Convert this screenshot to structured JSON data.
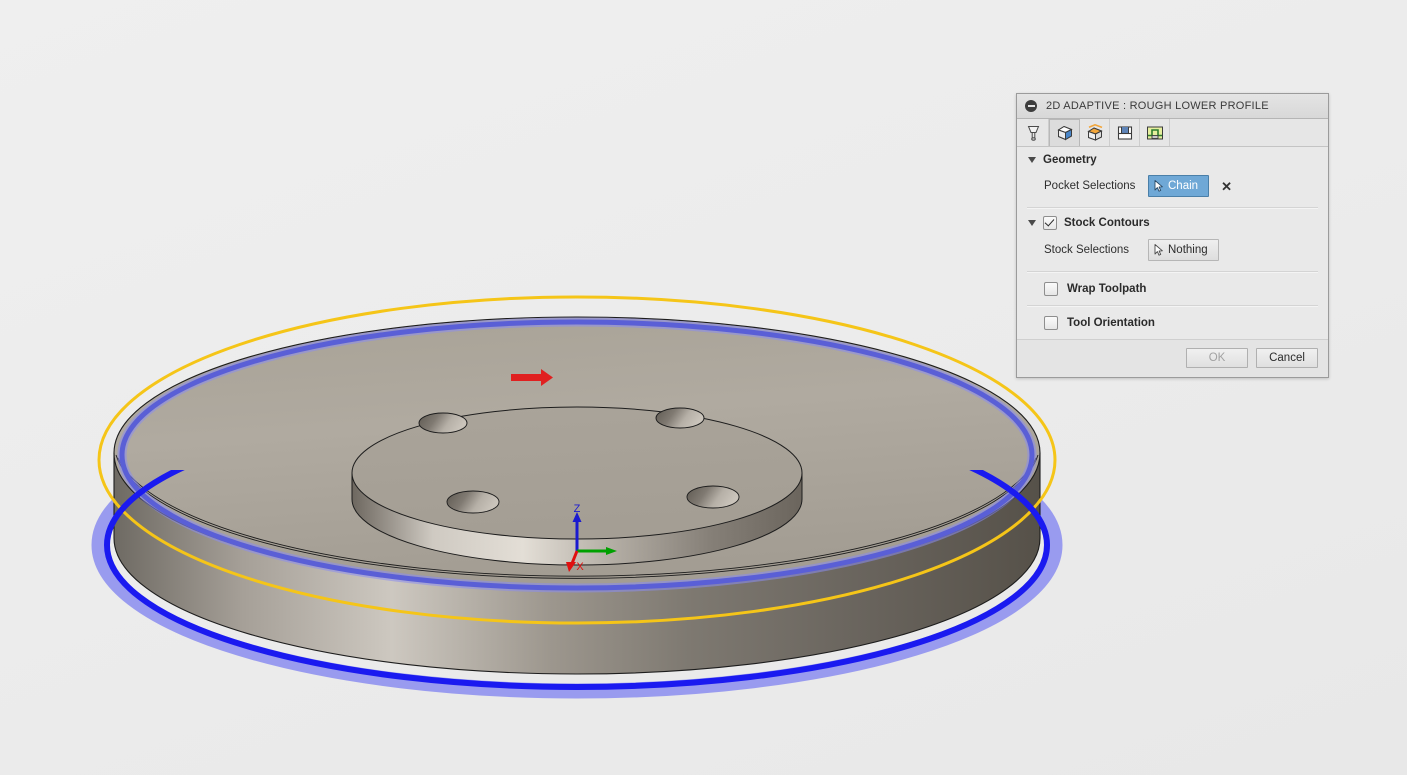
{
  "viewport": {
    "name": "cam-3d-viewport",
    "background_color": "#ececec",
    "model": {
      "description": "Cylindrical disc part with recessed circular pocket and four bolt holes",
      "body_color": "#a9a49a",
      "edge_color": "#1a1a1a"
    },
    "overlays": {
      "stock_contour_color": "#f5c518",
      "chain_top_color": "#5a5fd6",
      "chain_bottom_color": "#1a1af0",
      "chain_glow_color": "#8b8df0",
      "direction_arrow_color": "#e02020"
    },
    "axis_triad": {
      "z_label": "Z",
      "x_label": "X",
      "z_color": "#1a1ad0",
      "y_color": "#00a000",
      "x_color": "#e01010"
    }
  },
  "dialog": {
    "title": "2D ADAPTIVE : ROUGH LOWER PROFILE",
    "collapse_icon": "collapse-minus-icon",
    "tabs": [
      {
        "key": "tool",
        "label": "Tool",
        "icon": "endmill-tool-icon",
        "active": false
      },
      {
        "key": "geometry",
        "label": "Geometry",
        "icon": "geometry-cube-icon",
        "active": true
      },
      {
        "key": "heights",
        "label": "Heights",
        "icon": "heights-cube-icon",
        "active": false
      },
      {
        "key": "passes",
        "label": "Passes",
        "icon": "passes-section-icon",
        "active": false
      },
      {
        "key": "linking",
        "label": "Linking",
        "icon": "linking-toolpath-icon",
        "active": false
      }
    ],
    "sections": {
      "geometry": {
        "header": "Geometry",
        "expanded": true,
        "pocket_selections": {
          "label": "Pocket Selections",
          "value": "Chain",
          "selected": true,
          "cursor_icon": "selection-cursor-icon",
          "clear_icon": "clear-x-icon"
        }
      },
      "stock_contours": {
        "header": "Stock Contours",
        "expanded": true,
        "checked": true,
        "stock_selections": {
          "label": "Stock Selections",
          "value": "Nothing",
          "selected": false,
          "cursor_icon": "selection-cursor-icon"
        }
      },
      "wrap_toolpath": {
        "label": "Wrap Toolpath",
        "checked": false
      },
      "tool_orientation": {
        "label": "Tool Orientation",
        "checked": false
      }
    },
    "footer": {
      "ok_label": "OK",
      "ok_enabled": false,
      "cancel_label": "Cancel"
    },
    "colors": {
      "panel_bg": "#e9e9e9",
      "selected_button": "#6fa8d6",
      "border": "#9b9b9b"
    }
  }
}
